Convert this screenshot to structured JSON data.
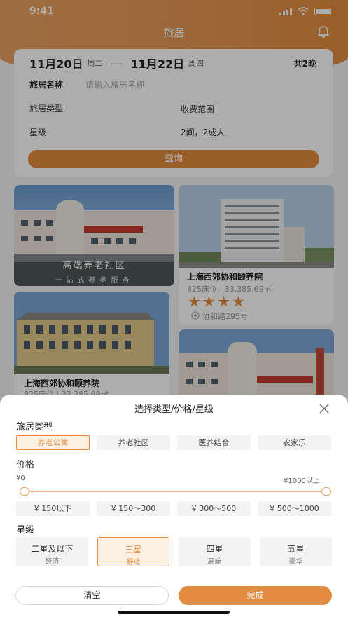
{
  "status": {
    "time": "9:41"
  },
  "nav": {
    "title": "旅居",
    "bell_icon": "bell-icon"
  },
  "search": {
    "start_date": "11月20日",
    "start_weekday": "周二",
    "dash": "—",
    "end_date": "11月22日",
    "end_weekday": "周四",
    "nights": "共2晚",
    "name_label": "旅居名称",
    "name_placeholder": "请输入旅居名称",
    "type_label": "旅居类型",
    "fee_label": "收费范围",
    "star_label": "星级",
    "guests": "2间，2成人",
    "query_button": "查询"
  },
  "listings": [
    {
      "overlay_title": "高端养老社区",
      "overlay_sub": "一站式养老服务"
    },
    {
      "title": "上海西郊协和颐养院",
      "sub": "825床位 | 33,385.69㎡",
      "rating": 4,
      "address": "协和路295号"
    },
    {
      "title": "上海西郊协和颐养院",
      "sub": "825床位 | 33,385.69㎡"
    }
  ],
  "sheet": {
    "title": "选择类型/价格/星级",
    "type_section": "旅居类型",
    "types": [
      {
        "label": "养老公寓",
        "selected": true
      },
      {
        "label": "养老社区",
        "selected": false
      },
      {
        "label": "医养结合",
        "selected": false
      },
      {
        "label": "农家乐",
        "selected": false
      }
    ],
    "price_section": "价格",
    "price_min_label": "¥0",
    "price_max_label": "¥1000以上",
    "price_range_selected": [
      0,
      1000
    ],
    "price_options": [
      "¥ 150以下",
      "¥ 150～300",
      "¥ 300～500",
      "¥ 500～1000"
    ],
    "star_section": "星级",
    "stars": [
      {
        "title": "二星及以下",
        "sub": "经济",
        "selected": false
      },
      {
        "title": "三星",
        "sub": "舒适",
        "selected": true
      },
      {
        "title": "四星",
        "sub": "高端",
        "selected": false
      },
      {
        "title": "五星",
        "sub": "豪华",
        "selected": false
      }
    ],
    "clear_button": "清空",
    "done_button": "完成"
  },
  "colors": {
    "accent": "#e38b40",
    "selected_bg": "#fdf0e5"
  }
}
